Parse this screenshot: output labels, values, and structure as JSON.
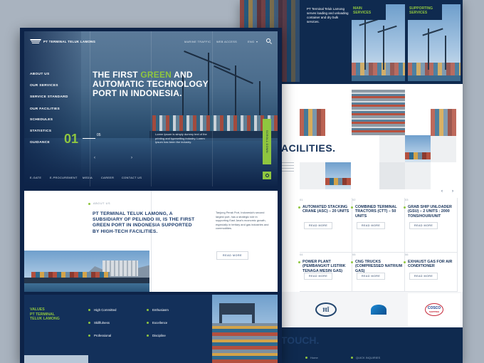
{
  "front": {
    "brand": "PT TERMINAL TELUK LAMONG",
    "top_links": [
      "MARINE TRAFFIC",
      "WEB ACCESS",
      "ENG"
    ],
    "sidebar": [
      "ABOUT US",
      "OUR SERVICES",
      "SERVICE STANDARD",
      "OUR FACILITIES",
      "SCHEDULES",
      "STATISTICS",
      "GUIDANCE"
    ],
    "hero_title_pre": "THE FIRST ",
    "hero_title_accent": "GREEN",
    "hero_title_post": " AND AUTOMATIC TECHNOLOGY PORT IN INDONESIA.",
    "slide_current": "01",
    "slide_total": "05",
    "hero_desc": "Lorem Ipsum is simply dummy text of the printing and typesetting industry. Lorem Ipsum has been the industry.",
    "scroll_label": "SCROLL DOWN",
    "footer_links": [
      "E-GATE",
      "E-PROCUREMENT",
      "MEDIA",
      "CAREER",
      "CONTACT US"
    ],
    "about_label": "ABOUT US",
    "about_title": "PT TERMINAL TELUK LAMONG, A SUBSIDIARY OF PELINDO III, IS THE FIRST GREEN PORT IN INDONESIA SUPPORTED BY HIGH-TECH FACILITIES.",
    "about_desc": "Tanjung Perak Port, Indonesia's second largest port, has a strategic role in supporting East Java's economic growth, especially in tertiary and gas industries and commodities.",
    "read_more": "READ MORE",
    "values_title": [
      "VALUES",
      "PT TERMINAL",
      "TELUK LAMONG"
    ],
    "values": [
      "High Committed",
      "Enthusiasm",
      "Skillfulness",
      "Excellence",
      "Professional",
      "Discipline"
    ]
  },
  "back": {
    "intro_text": "PT Terminal Teluk Lamong serves loading and unloading container and dry bulk services.",
    "main_services": "MAIN SERVICES",
    "supporting_services": "SUPPORTING SERVICES",
    "facilities_heading": "ACILITIES.",
    "facilities": [
      {
        "num": "01",
        "title": "AUTOMATED STACKING CRANE (ASC) – 20 UNITS"
      },
      {
        "num": "02",
        "title": "COMBINED TERMINAL TRACTORS (CTT) – 50 UNITS"
      },
      {
        "num": "03",
        "title": "GRAB SHIP UNLOADER (GSU) – 2 UNITS : 2000 TONS/HOUR/UNIT"
      },
      {
        "num": "04",
        "title": "POWER PLANT (PEMBANGKIT LISTRIK TENAGA MESIN GAS)"
      },
      {
        "num": "05",
        "title": "CNG TRUCKS (COMPRESSED NATRIUM GAS)"
      },
      {
        "num": "06",
        "title": "EXHAUST GAS FOR AIR CONDITIONER"
      }
    ],
    "read_more": "READ MORE",
    "logo_labels": [
      "COSCO",
      "SHIPPING"
    ],
    "touch_heading": "TOUCH.",
    "footer_items": [
      "Home",
      "QUICK INQUIRIES"
    ]
  }
}
